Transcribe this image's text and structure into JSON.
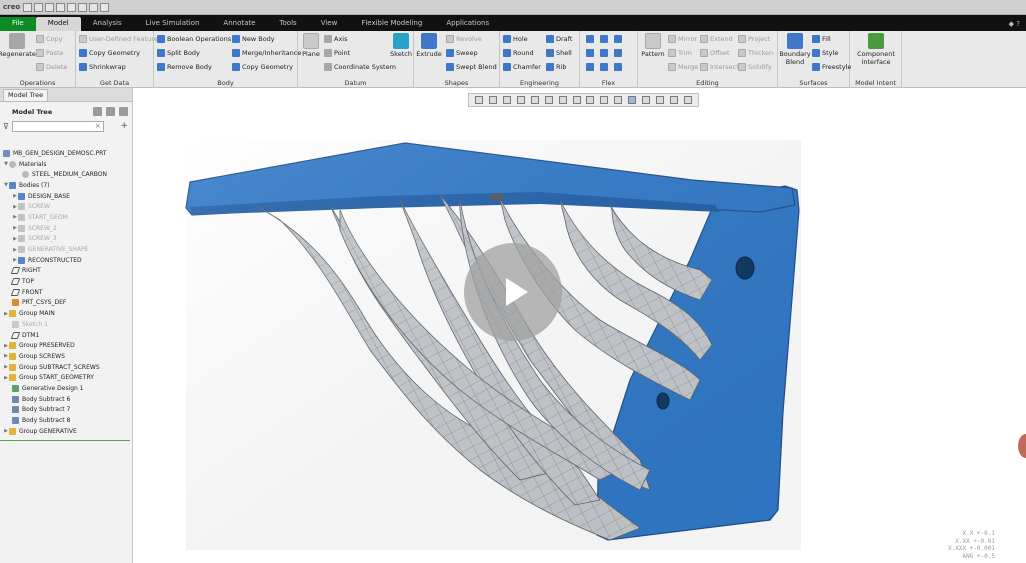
{
  "app": {
    "logo": "creo"
  },
  "tabs": {
    "file": "File",
    "model": "Model",
    "analysis": "Analysis",
    "live_simulation": "Live Simulation",
    "annotate": "Annotate",
    "tools": "Tools",
    "view": "View",
    "flexible_modeling": "Flexible Modeling",
    "applications": "Applications"
  },
  "ribbon": {
    "operations": {
      "label": "Operations",
      "regenerate": "Regenerate",
      "copy": "Copy",
      "paste": "Paste",
      "delete": "Delete"
    },
    "get_data": {
      "label": "Get Data",
      "udf": "User-Defined Feature",
      "copy_geometry": "Copy Geometry",
      "shrinkwrap": "Shrinkwrap"
    },
    "body": {
      "label": "Body",
      "boolean": "Boolean Operations",
      "new_body": "New Body",
      "split_body": "Split Body",
      "merge_inheritance": "Merge/Inheritance",
      "remove_body": "Remove Body",
      "copy_geometry": "Copy Geometry"
    },
    "datum": {
      "label": "Datum",
      "plane": "Plane",
      "axis": "Axis",
      "point": "Point",
      "coordinate_system": "Coordinate System",
      "sketch": "Sketch"
    },
    "shapes": {
      "label": "Shapes",
      "extrude": "Extrude",
      "revolve": "Revolve",
      "sweep": "Sweep",
      "swept_blend": "Swept Blend"
    },
    "engineering": {
      "label": "Engineering",
      "hole": "Hole",
      "draft": "Draft",
      "round": "Round",
      "shell": "Shell",
      "chamfer": "Chamfer",
      "rib": "Rib"
    },
    "flex": {
      "label": "Flex"
    },
    "editing": {
      "label": "Editing",
      "pattern": "Pattern",
      "mirror": "Mirror",
      "extend": "Extend",
      "project": "Project",
      "trim": "Trim",
      "offset": "Offset",
      "thicken": "Thicken",
      "merge": "Merge",
      "intersect": "Intersect",
      "solidify": "Solidify"
    },
    "surfaces": {
      "label": "Surfaces",
      "fill": "Fill",
      "style": "Style",
      "boundary_blend": "Boundary Blend",
      "freestyle": "Freestyle"
    },
    "model_intent": {
      "label": "Model Intent",
      "component_interface": "Component Interface"
    }
  },
  "left_panel": {
    "tab": "Model Tree",
    "tree_label": "Model Tree",
    "filter_placeholder": "",
    "items": [
      {
        "label": "MB_GEN_DESIGN_DEMOSC.PRT"
      },
      {
        "label": "Materials"
      },
      {
        "label": "STEEL_MEDIUM_CARBON"
      },
      {
        "label": "Bodies (7)"
      },
      {
        "label": "DESIGN_BASE"
      },
      {
        "label": "SCREW"
      },
      {
        "label": "START_GEOM"
      },
      {
        "label": "SCREW_2"
      },
      {
        "label": "SCREW_3"
      },
      {
        "label": "GENERATIVE_SHAPE"
      },
      {
        "label": "RECONSTRUCTED"
      },
      {
        "label": "RIGHT"
      },
      {
        "label": "TOP"
      },
      {
        "label": "FRONT"
      },
      {
        "label": "PRT_CSYS_DEF"
      },
      {
        "label": "Group MAIN"
      },
      {
        "label": "Sketch 1"
      },
      {
        "label": "DTM1"
      },
      {
        "label": "Group PRESERVED"
      },
      {
        "label": "Group SCREWS"
      },
      {
        "label": "Group SUBTRACT_SCREWS"
      },
      {
        "label": "Group START_GEOMETRY"
      },
      {
        "label": "Generative Design 1"
      },
      {
        "label": "Body Subtract 6"
      },
      {
        "label": "Body Subtract 7"
      },
      {
        "label": "Body Subtract 8"
      },
      {
        "label": "Group GENERATIVE"
      }
    ]
  },
  "tolerance": {
    "line1": "X.X +-0.1",
    "line2": "X.XX +-0.01",
    "line3": "X.XXX +-0.001",
    "line4": "ANG +-0.5"
  },
  "colors": {
    "part_blue": "#2f78c8",
    "mesh_grey": "#c4c8cc",
    "file_tab": "#0c8a24",
    "ribbon_dark": "#111111"
  }
}
